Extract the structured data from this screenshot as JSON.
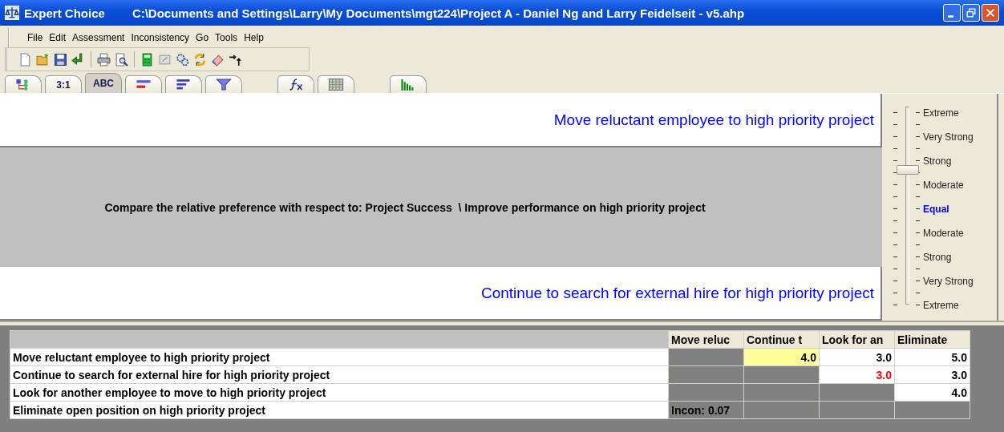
{
  "window": {
    "app": "Expert Choice",
    "title": "C:\\Documents and Settings\\Larry\\My Documents\\mgt224\\Project A - Daniel Ng and Larry Feidelseit - v5.ahp"
  },
  "menu": [
    "File",
    "Edit",
    "Assessment",
    "Inconsistency",
    "Go",
    "Tools",
    "Help"
  ],
  "tabs": [
    {
      "kind": "tree",
      "selected": false
    },
    {
      "kind": "text",
      "label": "3:1",
      "selected": false
    },
    {
      "kind": "text",
      "label": "ABC",
      "selected": true
    },
    {
      "kind": "pair",
      "selected": false
    },
    {
      "kind": "bars",
      "selected": false
    },
    {
      "kind": "funnel",
      "selected": false
    },
    {
      "kind": "formula",
      "selected": false
    },
    {
      "kind": "grid",
      "selected": false
    },
    {
      "kind": "chart",
      "selected": false
    }
  ],
  "comparison": {
    "top": "Move reluctant employee to high priority project",
    "prompt": "Compare the relative preference with respect to: Project Success  \\ Improve performance on high priority project",
    "bottom": "Continue to search for external hire for high priority project"
  },
  "scale": {
    "level": 0.6875,
    "labels": [
      {
        "text": "Extreme",
        "selected": false
      },
      {
        "text": "Very Strong",
        "selected": false
      },
      {
        "text": "Strong",
        "selected": false
      },
      {
        "text": "Moderate",
        "selected": false
      },
      {
        "text": "Equal",
        "selected": true
      },
      {
        "text": "Moderate",
        "selected": false
      },
      {
        "text": "Strong",
        "selected": false
      },
      {
        "text": "Very Strong",
        "selected": false
      },
      {
        "text": "Extreme",
        "selected": false
      }
    ]
  },
  "table": {
    "columns": [
      "Move reluc",
      "Continue t",
      "Look for an",
      "Eliminate"
    ],
    "rows": [
      {
        "name": "Move reluctant employee to high priority project",
        "cells": [
          {
            "kind": "empty"
          },
          {
            "kind": "value",
            "text": "4.0",
            "selected": true,
            "inverted": false
          },
          {
            "kind": "value",
            "text": "3.0",
            "selected": false,
            "inverted": false
          },
          {
            "kind": "value",
            "text": "5.0",
            "selected": false,
            "inverted": false
          }
        ]
      },
      {
        "name": "Continue to search for external hire for high priority project",
        "cells": [
          {
            "kind": "empty"
          },
          {
            "kind": "empty"
          },
          {
            "kind": "value",
            "text": "3.0",
            "selected": false,
            "inverted": true
          },
          {
            "kind": "value",
            "text": "3.0",
            "selected": false,
            "inverted": false
          }
        ]
      },
      {
        "name": "Look for another employee to move to high priority project",
        "cells": [
          {
            "kind": "empty"
          },
          {
            "kind": "empty"
          },
          {
            "kind": "empty"
          },
          {
            "kind": "value",
            "text": "4.0",
            "selected": false,
            "inverted": false
          }
        ]
      },
      {
        "name": "Eliminate open position on high priority project",
        "cells": [
          {
            "kind": "note",
            "text": "Incon: 0.07"
          },
          {
            "kind": "empty"
          },
          {
            "kind": "empty"
          },
          {
            "kind": "empty"
          }
        ]
      }
    ]
  }
}
